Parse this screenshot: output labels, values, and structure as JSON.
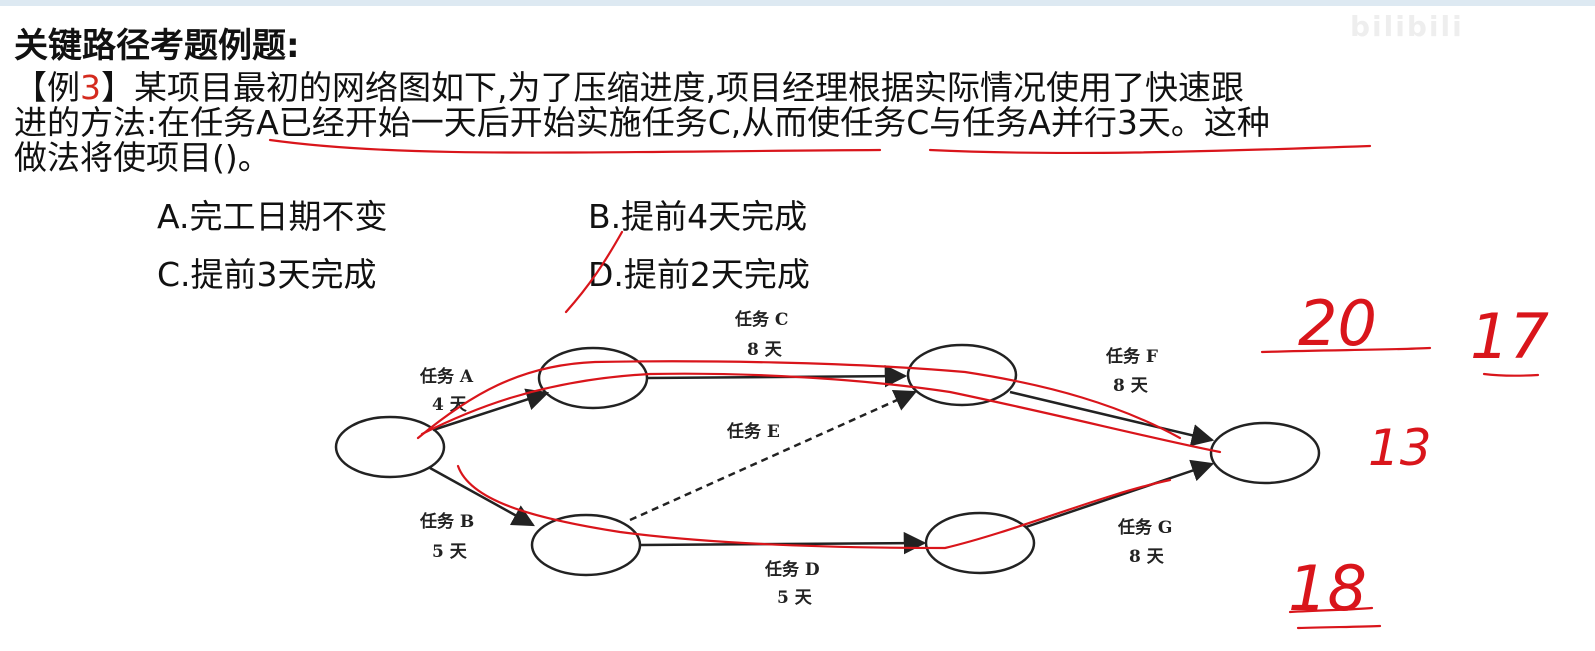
{
  "heading": "关键路径考题例题:",
  "question": {
    "open_bracket": "【",
    "example_label": "例",
    "example_number": "3",
    "close_bracket": "】",
    "text_line1": "某项目最初的网络图如下,为了压缩进度,项目经理根据实际情况使用了快速跟",
    "text_line2": "进的方法:在任务A已经开始一天后开始实施任务C,从而使任务C与任务A并行3天。这种",
    "text_line3": "做法将使项目()。"
  },
  "options": {
    "a": "A.完工日期不变",
    "b": "B.提前4天完成",
    "c": "C.提前3天完成",
    "d": "D.提前2天完成"
  },
  "diagram": {
    "task_a_name": "任务 A",
    "task_a_days": "4 天",
    "task_b_name": "任务 B",
    "task_b_days": "5 天",
    "task_c_name": "任务 C",
    "task_c_days": "8 天",
    "task_d_name": "任务 D",
    "task_d_days": "5 天",
    "task_e_name": "任务 E",
    "task_f_name": "任务 F",
    "task_f_days": "8 天",
    "task_g_name": "任务 G",
    "task_g_days": "8 天"
  },
  "handwriting": {
    "value_20": "20",
    "value_17": "17",
    "value_13": "13",
    "value_18": "18"
  },
  "watermark": "bilibili",
  "colors": {
    "annotation": "#d9151b",
    "highlight_number": "#d42a1e",
    "diagram": "#222222"
  }
}
